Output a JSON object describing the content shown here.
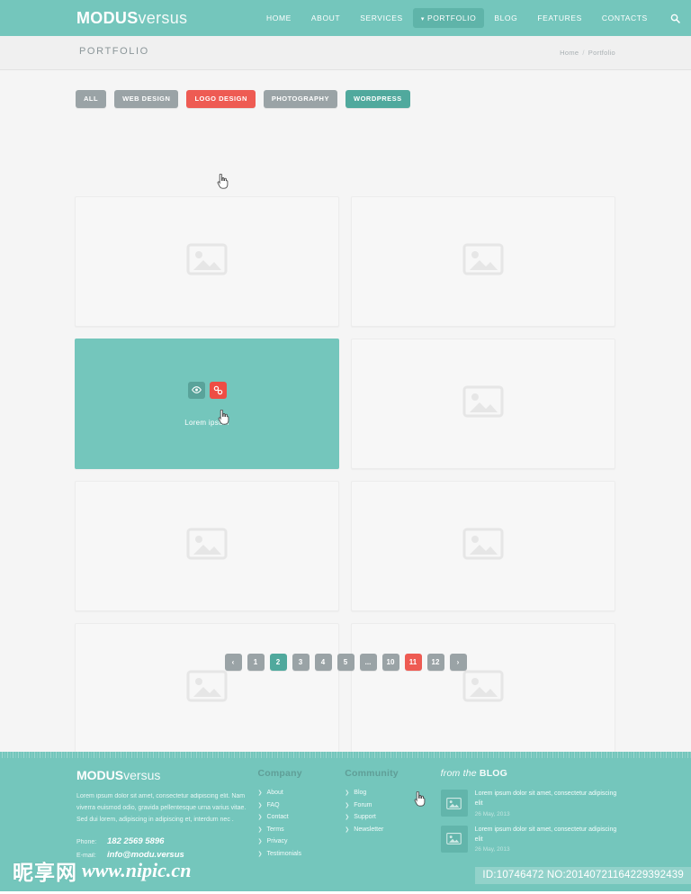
{
  "header": {
    "logo_bold": "MODUS",
    "logo_light": "versus",
    "nav": [
      {
        "label": "HOME",
        "active": false
      },
      {
        "label": "ABOUT",
        "active": false
      },
      {
        "label": "SERVICES",
        "active": false
      },
      {
        "label": "PORTFOLIO",
        "active": true
      },
      {
        "label": "BLOG",
        "active": false
      },
      {
        "label": "FEATURES",
        "active": false
      },
      {
        "label": "CONTACTS",
        "active": false
      }
    ],
    "search_icon": "search-icon",
    "bg_color": "#74c6bc"
  },
  "titlebar": {
    "title": "PORTFOLIO",
    "breadcrumb_home": "Home",
    "breadcrumb_sep": "/",
    "breadcrumb_current": "Portfolio"
  },
  "filters": [
    {
      "label": "ALL",
      "state": "default"
    },
    {
      "label": "WEB DESIGN",
      "state": "default"
    },
    {
      "label": "LOGO DESIGN",
      "state": "hover"
    },
    {
      "label": "PHOTOGRAPHY",
      "state": "default"
    },
    {
      "label": "WORDPRESS",
      "state": "selected"
    }
  ],
  "portfolio": {
    "items": [
      {
        "caption": "",
        "state": "default"
      },
      {
        "caption": "",
        "state": "default"
      },
      {
        "caption": "Lorem ipsum",
        "state": "hover"
      },
      {
        "caption": "",
        "state": "default"
      },
      {
        "caption": "",
        "state": "default"
      },
      {
        "caption": "",
        "state": "default"
      },
      {
        "caption": "",
        "state": "default"
      },
      {
        "caption": "",
        "state": "default"
      }
    ],
    "hover_actions": {
      "preview_icon": "eye-icon",
      "link_icon": "link-icon"
    },
    "placeholder_icon": "image-placeholder-icon"
  },
  "pagination": {
    "prev_label": "‹",
    "next_label": "›",
    "pages": [
      {
        "label": "1",
        "state": "default"
      },
      {
        "label": "2",
        "state": "active"
      },
      {
        "label": "3",
        "state": "default"
      },
      {
        "label": "4",
        "state": "default"
      },
      {
        "label": "5",
        "state": "default"
      },
      {
        "label": "...",
        "state": "default"
      },
      {
        "label": "10",
        "state": "default"
      },
      {
        "label": "11",
        "state": "hover"
      },
      {
        "label": "12",
        "state": "default"
      }
    ]
  },
  "footer": {
    "logo_bold": "MODUS",
    "logo_light": "versus",
    "about_text": "Lorem ipsum dolor sit amet, consectetur adipiscing elit. Nam viverra euismod odio, gravida pellentesque urna varius vitae. Sed dui lorem, adipiscing in adipiscing et, interdum nec .",
    "phone_label": "Phone:",
    "phone_value": "182 2569 5896",
    "email_label": "E-mail:",
    "email_value": "info@modu.versus",
    "company": {
      "heading": "Company",
      "links": [
        "About",
        "FAQ",
        "Contact",
        "Terms",
        "Privacy",
        "Testimonials"
      ]
    },
    "community": {
      "heading": "Community",
      "links": [
        "Blog",
        "Forum",
        "Support",
        "Newsletter"
      ]
    },
    "blog": {
      "heading_italic": "from the ",
      "heading_bold": "BLOG",
      "posts": [
        {
          "title": "Lorem ipsum dolor sit amet, consectetur adipiscing elit",
          "date": "26 May, 2013"
        },
        {
          "title": "Lorem ipsum dolor sit amet, consectetur adipiscing elit",
          "date": "26 May, 2013"
        }
      ]
    }
  },
  "watermark": {
    "cjk": "昵享网",
    "url": "www.nipic.cn",
    "id_text": "ID:10746472 NO:20140721164229392439"
  },
  "colors": {
    "teal": "#74c6bc",
    "teal_dark": "#50a99d",
    "red": "#ee5b53",
    "gray": "#9aa3a6"
  }
}
